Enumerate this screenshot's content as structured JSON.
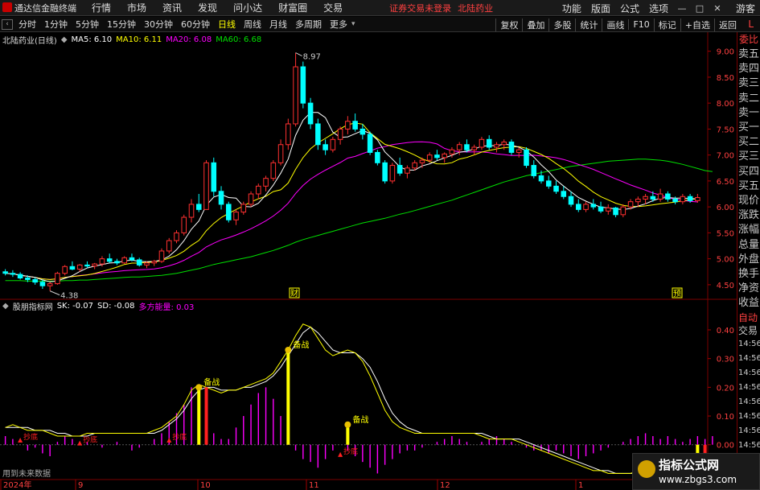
{
  "menubar": {
    "app_title": "通达信金融终端",
    "items": [
      "行情",
      "市场",
      "资讯",
      "发现",
      "问小达",
      "财富圈",
      "交易"
    ],
    "notice": "证券交易未登录",
    "stock_name_notice": "北陆药业",
    "right_items": [
      "功能",
      "版面",
      "公式",
      "选项"
    ],
    "guest": "游客",
    "window_buttons": [
      "—",
      "□",
      "✕"
    ]
  },
  "toolbar": {
    "periods": [
      "分时",
      "1分钟",
      "5分钟",
      "15分钟",
      "30分钟",
      "60分钟",
      "日线",
      "周线",
      "月线",
      "多周期",
      "更多"
    ],
    "active_period": "日线",
    "right_items": [
      "复权",
      "叠加",
      "多股",
      "统计",
      "画线",
      "F10",
      "标记",
      "+自选",
      "返回"
    ],
    "corner": "L"
  },
  "main_panel": {
    "stock_label": "北陆药业(日线)",
    "ma5": "MA5: 6.10",
    "ma10": "MA10: 6.11",
    "ma20": "MA20: 6.08",
    "ma60": "MA60: 6.68",
    "high_label": "8.97",
    "low_label": "4.38",
    "marker_cai": "财",
    "marker_yu": "预",
    "colors": {
      "ma5": "#ffffff",
      "ma10": "#ffff00",
      "ma20": "#ff00ff",
      "ma60": "#00e000",
      "up": "#ff3030",
      "down": "#00ffff"
    }
  },
  "indicator_panel": {
    "name": "股朋指标网",
    "sk": "SK: -0.07",
    "sd": "SD: -0.08",
    "energy": "多方能量: 0.03",
    "note": "用到未来数据",
    "signal_beixi": "备战",
    "signal_dingzhuo": "抄底"
  },
  "xaxis": {
    "labels": [
      "2024年",
      "9",
      "10",
      "11",
      "12",
      "1"
    ]
  },
  "chart_data": [
    {
      "type": "candlestick",
      "title": "北陆药业(日线)",
      "ylim": [
        4.25,
        9.15
      ],
      "yticks": [
        4.5,
        5.0,
        5.5,
        6.0,
        6.5,
        7.0,
        7.5,
        8.0,
        8.5,
        9.0
      ],
      "ohlc": [
        [
          4.75,
          4.8,
          4.68,
          4.72
        ],
        [
          4.72,
          4.78,
          4.65,
          4.7
        ],
        [
          4.7,
          4.74,
          4.6,
          4.63
        ],
        [
          4.63,
          4.68,
          4.55,
          4.6
        ],
        [
          4.6,
          4.64,
          4.5,
          4.55
        ],
        [
          4.55,
          4.6,
          4.42,
          4.48
        ],
        [
          4.48,
          4.55,
          4.38,
          4.52
        ],
        [
          4.52,
          4.75,
          4.5,
          4.72
        ],
        [
          4.72,
          4.88,
          4.68,
          4.85
        ],
        [
          4.85,
          4.95,
          4.78,
          4.8
        ],
        [
          4.8,
          4.9,
          4.75,
          4.88
        ],
        [
          4.88,
          4.95,
          4.82,
          4.86
        ],
        [
          4.86,
          4.92,
          4.8,
          4.9
        ],
        [
          4.9,
          5.05,
          4.85,
          5.0
        ],
        [
          5.0,
          5.1,
          4.92,
          4.95
        ],
        [
          4.95,
          5.0,
          4.88,
          4.92
        ],
        [
          4.92,
          5.05,
          4.9,
          5.02
        ],
        [
          5.02,
          5.1,
          4.95,
          4.98
        ],
        [
          4.98,
          5.02,
          4.85,
          4.88
        ],
        [
          4.88,
          4.95,
          4.82,
          4.92
        ],
        [
          4.92,
          4.98,
          4.86,
          4.95
        ],
        [
          4.95,
          5.2,
          4.92,
          5.15
        ],
        [
          5.15,
          5.4,
          5.1,
          5.35
        ],
        [
          5.35,
          5.55,
          5.3,
          5.5
        ],
        [
          5.5,
          5.85,
          5.45,
          5.8
        ],
        [
          5.8,
          6.15,
          5.7,
          6.05
        ],
        [
          6.05,
          6.25,
          5.9,
          5.95
        ],
        [
          5.95,
          6.9,
          5.95,
          6.85
        ],
        [
          6.85,
          6.95,
          6.2,
          6.3
        ],
        [
          6.3,
          6.4,
          5.95,
          6.05
        ],
        [
          6.05,
          6.1,
          5.7,
          5.75
        ],
        [
          5.75,
          5.95,
          5.65,
          5.9
        ],
        [
          5.9,
          6.1,
          5.85,
          6.05
        ],
        [
          6.05,
          6.3,
          6.0,
          6.25
        ],
        [
          6.25,
          6.45,
          6.15,
          6.4
        ],
        [
          6.4,
          6.6,
          6.3,
          6.55
        ],
        [
          6.55,
          6.9,
          6.5,
          6.85
        ],
        [
          6.85,
          7.3,
          6.8,
          7.2
        ],
        [
          7.2,
          7.7,
          7.1,
          7.6
        ],
        [
          7.6,
          8.97,
          7.55,
          8.7
        ],
        [
          8.7,
          8.8,
          7.9,
          8.0
        ],
        [
          8.0,
          8.1,
          7.5,
          7.6
        ],
        [
          7.6,
          7.7,
          7.1,
          7.2
        ],
        [
          7.2,
          7.3,
          7.0,
          7.1
        ],
        [
          7.1,
          7.35,
          7.05,
          7.3
        ],
        [
          7.3,
          7.55,
          7.2,
          7.5
        ],
        [
          7.5,
          7.75,
          7.4,
          7.65
        ],
        [
          7.65,
          7.8,
          7.45,
          7.5
        ],
        [
          7.5,
          7.6,
          7.3,
          7.4
        ],
        [
          7.4,
          7.45,
          7.0,
          7.05
        ],
        [
          7.05,
          7.1,
          6.8,
          6.85
        ],
        [
          6.85,
          6.9,
          6.45,
          6.5
        ],
        [
          6.5,
          6.85,
          6.45,
          6.8
        ],
        [
          6.8,
          6.95,
          6.6,
          6.65
        ],
        [
          6.65,
          6.8,
          6.55,
          6.75
        ],
        [
          6.75,
          6.9,
          6.7,
          6.85
        ],
        [
          6.85,
          6.95,
          6.75,
          6.9
        ],
        [
          6.9,
          7.05,
          6.85,
          7.0
        ],
        [
          7.0,
          7.1,
          6.9,
          6.95
        ],
        [
          6.95,
          7.05,
          6.85,
          7.02
        ],
        [
          7.02,
          7.15,
          6.95,
          7.1
        ],
        [
          7.1,
          7.25,
          7.0,
          7.2
        ],
        [
          7.2,
          7.3,
          7.05,
          7.1
        ],
        [
          7.1,
          7.2,
          7.0,
          7.15
        ],
        [
          7.15,
          7.35,
          7.1,
          7.3
        ],
        [
          7.3,
          7.38,
          7.1,
          7.15
        ],
        [
          7.15,
          7.25,
          7.05,
          7.2
        ],
        [
          7.2,
          7.3,
          7.1,
          7.25
        ],
        [
          7.25,
          7.3,
          7.0,
          7.05
        ],
        [
          7.05,
          7.15,
          6.95,
          7.1
        ],
        [
          7.1,
          7.15,
          6.75,
          6.8
        ],
        [
          6.8,
          6.9,
          6.55,
          6.6
        ],
        [
          6.6,
          6.7,
          6.45,
          6.5
        ],
        [
          6.5,
          6.6,
          6.35,
          6.4
        ],
        [
          6.4,
          6.5,
          6.25,
          6.3
        ],
        [
          6.3,
          6.4,
          6.15,
          6.2
        ],
        [
          6.2,
          6.3,
          6.0,
          6.05
        ],
        [
          6.05,
          6.15,
          5.9,
          5.95
        ],
        [
          5.95,
          6.1,
          5.9,
          6.05
        ],
        [
          6.05,
          6.15,
          5.95,
          6.0
        ],
        [
          6.0,
          6.1,
          5.88,
          5.92
        ],
        [
          5.92,
          6.05,
          5.85,
          5.98
        ],
        [
          5.98,
          6.0,
          5.8,
          5.85
        ],
        [
          5.85,
          6.05,
          5.8,
          6.0
        ],
        [
          6.0,
          6.15,
          5.95,
          6.1
        ],
        [
          6.1,
          6.2,
          6.0,
          6.15
        ],
        [
          6.15,
          6.25,
          6.05,
          6.2
        ],
        [
          6.2,
          6.3,
          6.1,
          6.15
        ],
        [
          6.15,
          6.35,
          6.1,
          6.25
        ],
        [
          6.25,
          6.3,
          6.1,
          6.15
        ],
        [
          6.15,
          6.2,
          6.05,
          6.1
        ],
        [
          6.1,
          6.25,
          6.05,
          6.2
        ],
        [
          6.2,
          6.25,
          6.08,
          6.12
        ],
        [
          6.12,
          6.25,
          6.08,
          6.18
        ]
      ],
      "ma60": [
        4.58,
        4.58,
        4.58,
        4.57,
        4.57,
        4.57,
        4.57,
        4.57,
        4.58,
        4.58,
        4.59,
        4.59,
        4.6,
        4.61,
        4.62,
        4.63,
        4.64,
        4.65,
        4.65,
        4.66,
        4.67,
        4.68,
        4.7,
        4.72,
        4.75,
        4.78,
        4.81,
        4.85,
        4.89,
        4.92,
        4.95,
        4.98,
        5.01,
        5.04,
        5.08,
        5.12,
        5.16,
        5.21,
        5.26,
        5.32,
        5.37,
        5.41,
        5.45,
        5.49,
        5.53,
        5.57,
        5.61,
        5.65,
        5.69,
        5.72,
        5.75,
        5.78,
        5.82,
        5.86,
        5.89,
        5.93,
        5.97,
        6.01,
        6.05,
        6.09,
        6.13,
        6.18,
        6.23,
        6.28,
        6.33,
        6.38,
        6.43,
        6.48,
        6.52,
        6.56,
        6.6,
        6.63,
        6.66,
        6.69,
        6.72,
        6.75,
        6.78,
        6.8,
        6.82,
        6.84,
        6.86,
        6.88,
        6.89,
        6.9,
        6.91,
        6.92,
        6.92,
        6.91,
        6.9,
        6.88,
        6.85,
        6.82,
        6.78,
        6.74,
        6.7,
        6.68
      ]
    },
    {
      "type": "line",
      "title": "股朋指标网",
      "ylim": [
        -0.11,
        0.47
      ],
      "yticks": [
        0.0,
        0.1,
        0.2,
        0.3,
        0.4
      ],
      "series": [
        {
          "name": "SK",
          "values": [
            0.06,
            0.07,
            0.06,
            0.05,
            0.05,
            0.05,
            0.04,
            0.03,
            0.03,
            0.03,
            0.03,
            0.04,
            0.04,
            0.04,
            0.04,
            0.04,
            0.04,
            0.04,
            0.04,
            0.04,
            0.05,
            0.06,
            0.08,
            0.1,
            0.14,
            0.19,
            0.21,
            0.2,
            0.19,
            0.18,
            0.19,
            0.19,
            0.2,
            0.21,
            0.22,
            0.23,
            0.25,
            0.29,
            0.33,
            0.38,
            0.42,
            0.41,
            0.37,
            0.33,
            0.31,
            0.32,
            0.33,
            0.32,
            0.29,
            0.24,
            0.18,
            0.12,
            0.08,
            0.06,
            0.05,
            0.04,
            0.04,
            0.04,
            0.04,
            0.04,
            0.04,
            0.04,
            0.04,
            0.04,
            0.03,
            0.02,
            0.02,
            0.02,
            0.02,
            0.01,
            0.0,
            -0.01,
            -0.02,
            -0.03,
            -0.04,
            -0.05,
            -0.06,
            -0.07,
            -0.08,
            -0.09,
            -0.09,
            -0.1,
            -0.1,
            -0.1,
            -0.1,
            -0.09,
            -0.09,
            -0.08,
            -0.08,
            -0.07,
            -0.07,
            -0.07,
            -0.07,
            -0.07,
            -0.07,
            -0.07
          ]
        },
        {
          "name": "SD",
          "values": [
            0.06,
            0.06,
            0.06,
            0.06,
            0.05,
            0.05,
            0.05,
            0.04,
            0.04,
            0.03,
            0.03,
            0.03,
            0.04,
            0.04,
            0.04,
            0.04,
            0.04,
            0.04,
            0.04,
            0.04,
            0.04,
            0.05,
            0.07,
            0.09,
            0.12,
            0.16,
            0.19,
            0.2,
            0.2,
            0.19,
            0.19,
            0.19,
            0.2,
            0.2,
            0.21,
            0.22,
            0.24,
            0.27,
            0.31,
            0.35,
            0.39,
            0.41,
            0.39,
            0.36,
            0.33,
            0.32,
            0.32,
            0.32,
            0.3,
            0.27,
            0.22,
            0.16,
            0.11,
            0.08,
            0.06,
            0.05,
            0.04,
            0.04,
            0.04,
            0.04,
            0.04,
            0.04,
            0.04,
            0.04,
            0.04,
            0.03,
            0.02,
            0.02,
            0.02,
            0.02,
            0.01,
            0.0,
            -0.01,
            -0.02,
            -0.03,
            -0.04,
            -0.05,
            -0.06,
            -0.07,
            -0.08,
            -0.09,
            -0.09,
            -0.1,
            -0.1,
            -0.1,
            -0.1,
            -0.09,
            -0.09,
            -0.08,
            -0.08,
            -0.08,
            -0.08,
            -0.08,
            -0.08,
            -0.08,
            -0.08
          ]
        },
        {
          "name": "多方能量",
          "values": [
            0.03,
            0.02,
            0.0,
            -0.02,
            -0.01,
            -0.03,
            -0.04,
            0.01,
            0.03,
            0.02,
            0.0,
            0.01,
            0.0,
            -0.01,
            0.0,
            0.01,
            0.0,
            -0.02,
            -0.01,
            0.0,
            0.02,
            0.04,
            0.08,
            0.11,
            0.14,
            0.2,
            0.18,
            0.1,
            0.04,
            0.02,
            0.02,
            0.06,
            0.1,
            0.14,
            0.18,
            0.2,
            0.16,
            0.1,
            0.06,
            -0.02,
            -0.05,
            -0.06,
            -0.08,
            -0.05,
            -0.02,
            0.0,
            -0.02,
            -0.04,
            -0.06,
            -0.08,
            -0.1,
            -0.07,
            -0.05,
            -0.03,
            -0.02,
            -0.02,
            -0.01,
            0.0,
            0.01,
            0.02,
            0.03,
            0.02,
            0.01,
            0.0,
            0.01,
            0.02,
            0.03,
            0.02,
            0.01,
            0.0,
            -0.01,
            -0.02,
            -0.02,
            -0.03,
            -0.02,
            -0.03,
            -0.04,
            -0.05,
            -0.04,
            -0.03,
            -0.02,
            -0.01,
            0.0,
            0.01,
            0.02,
            0.03,
            0.04,
            0.03,
            0.02,
            0.03,
            0.02,
            0.01,
            0.02,
            0.03,
            0.02,
            0.03
          ]
        }
      ]
    }
  ],
  "right_panel": {
    "header": "委比",
    "labels": [
      "卖五",
      "卖四",
      "卖三",
      "卖二",
      "卖一",
      "买一",
      "买二",
      "买三",
      "买四",
      "买五",
      "现价",
      "涨跌",
      "涨幅",
      "总量",
      "外盘",
      "换手",
      "净资",
      "收益"
    ],
    "tab_auto": "自动",
    "tab_trade": "交易",
    "times": [
      "14:56",
      "14:56",
      "14:56",
      "14:56",
      "14:56",
      "14:56",
      "14:56",
      "14:56",
      "14:56"
    ]
  },
  "watermark": {
    "line1": "指标公式网",
    "line2": "www.zbgs3.com"
  }
}
